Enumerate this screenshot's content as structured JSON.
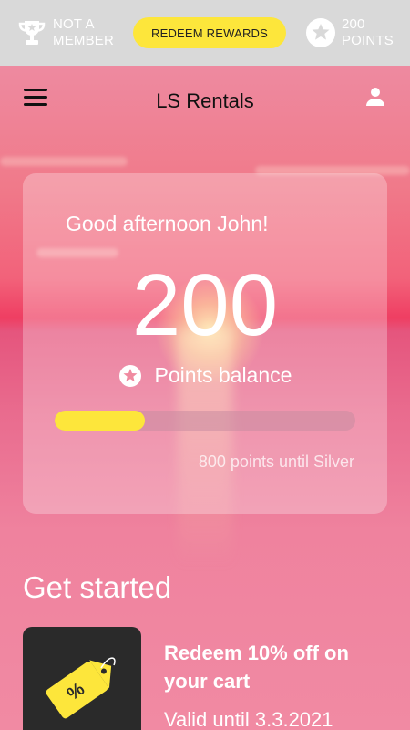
{
  "topbar": {
    "membership_text": "NOT A\nMEMBER",
    "redeem_label": "REDEEM REWARDS",
    "points_text": "200\nPOINTS"
  },
  "nav": {
    "title": "LS Rentals"
  },
  "card": {
    "greeting": "Good afternoon John!",
    "points": "200",
    "balance_label": "Points balance",
    "progress_fraction": 0.3,
    "until_text": "800 points until Silver"
  },
  "get_started": {
    "title": "Get started",
    "offer_title": "Redeem 10% off on your cart",
    "offer_valid": "Valid until 3.3.2021"
  },
  "colors": {
    "accent": "#fde63b",
    "topbar": "#d9d9d9",
    "tile": "#2a2a2a"
  },
  "icons": [
    "trophy-icon",
    "star-icon",
    "menu-icon",
    "user-icon",
    "price-tag-icon"
  ]
}
